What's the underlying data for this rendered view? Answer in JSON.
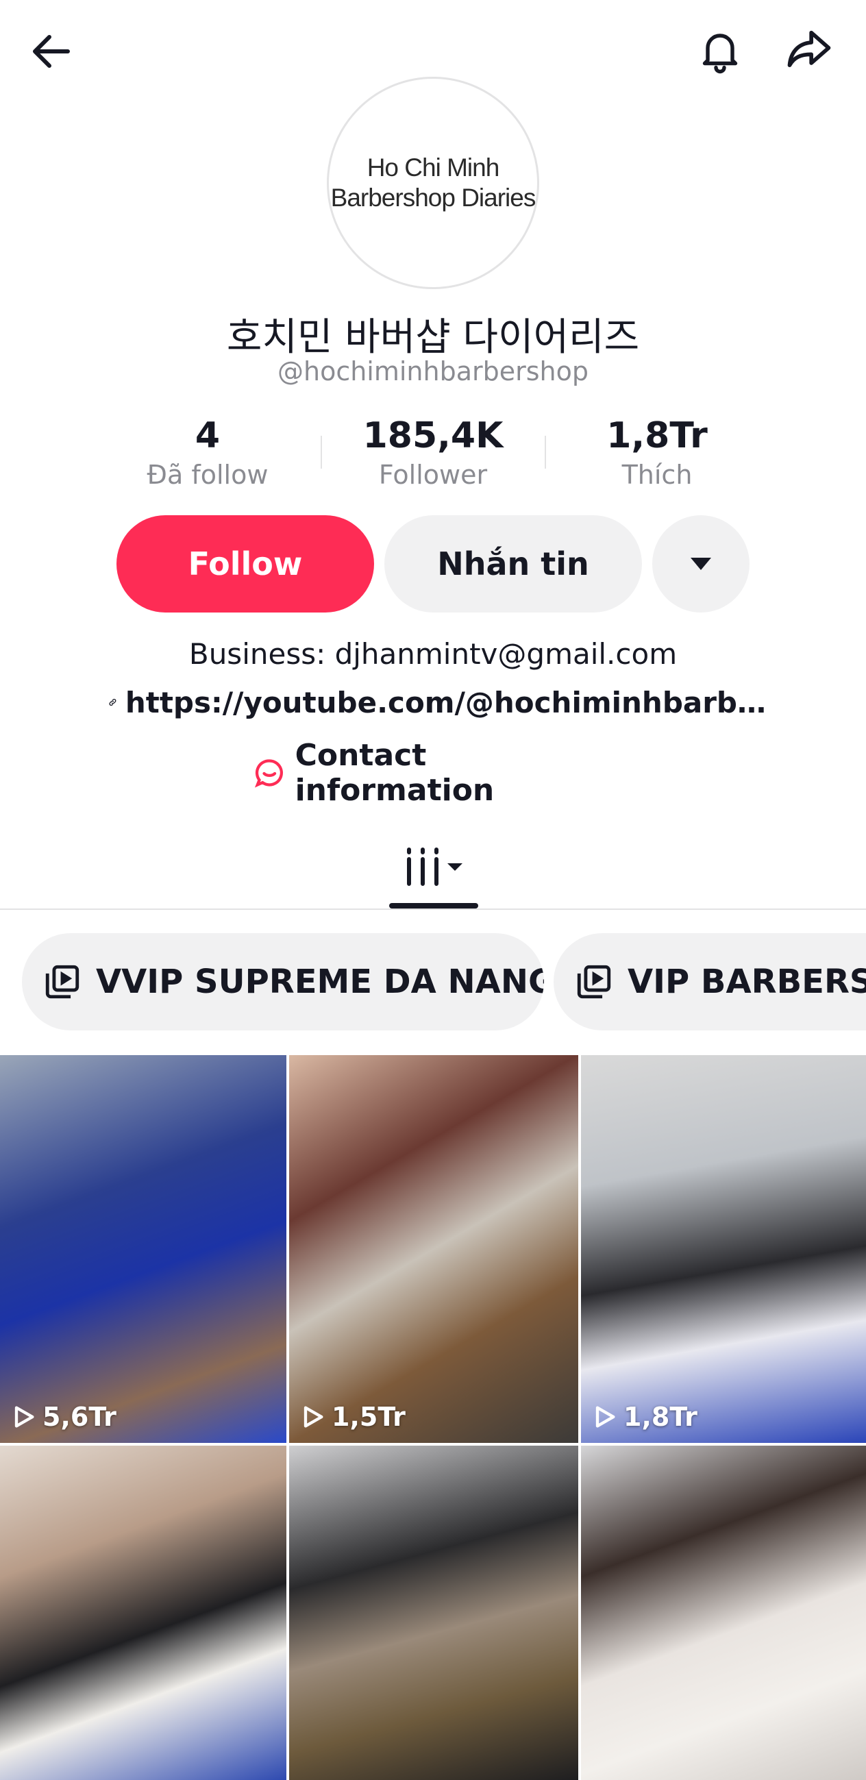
{
  "avatar": {
    "line1": "Ho Chi Minh",
    "line2": "Barbershop Diaries"
  },
  "profile": {
    "display_name": "호치민 바버샵 다이어리즈",
    "handle": "@hochiminhbarbershop"
  },
  "stats": [
    {
      "value": "4",
      "label": "Đã follow"
    },
    {
      "value": "185,4K",
      "label": "Follower"
    },
    {
      "value": "1,8Tr",
      "label": "Thích"
    }
  ],
  "actions": {
    "follow": "Follow",
    "message": "Nhắn tin"
  },
  "bio": {
    "business": "Business: djhanmintv@gmail.com",
    "link": "https://youtube.com/@hochiminhbarb…",
    "contact": "Contact information"
  },
  "playlists": [
    {
      "label": "VVIP SUPREME DA NANG"
    },
    {
      "label": "VIP BARBERSHOP"
    }
  ],
  "videos": [
    {
      "views": "5,6Tr"
    },
    {
      "views": "1,5Tr"
    },
    {
      "views": "1,8Tr"
    },
    {
      "views": ""
    },
    {
      "views": ""
    },
    {
      "views": ""
    }
  ],
  "colors": {
    "accent": "#fe2c55",
    "text": "#161823",
    "muted": "#8a8b91",
    "chip_bg": "#f1f1f2"
  }
}
